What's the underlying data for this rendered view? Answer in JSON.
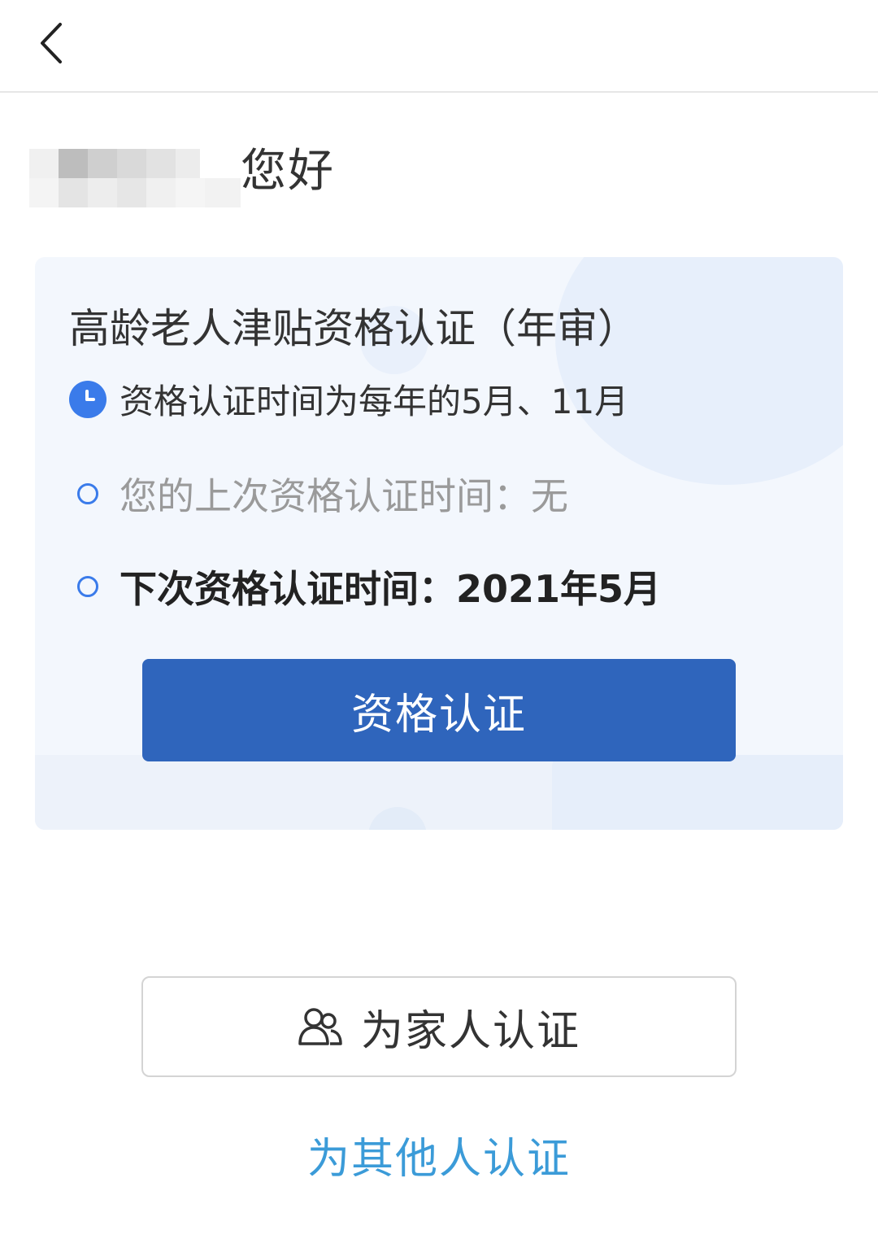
{
  "nav": {
    "back_icon": "chevron-left-icon"
  },
  "greeting": {
    "text": "您好"
  },
  "card": {
    "title": "高龄老人津贴资格认证（年审）",
    "rows": [
      {
        "icon": "clock-icon",
        "text": "资格认证时间为每年的5月、11月"
      },
      {
        "icon": "circle-dot-icon",
        "text": "您的上次资格认证时间：无"
      },
      {
        "icon": "circle-dot-icon",
        "text": "下次资格认证时间：2021年5月"
      }
    ],
    "button_label": "资格认证"
  },
  "family_button": {
    "icon": "users-icon",
    "label": "为家人认证"
  },
  "others_link": {
    "label": "为其他人认证"
  },
  "colors": {
    "primary": "#2f65bc",
    "accent": "#3a7bea",
    "link": "#3b9bd8",
    "card_bg": "#f3f7fd"
  }
}
